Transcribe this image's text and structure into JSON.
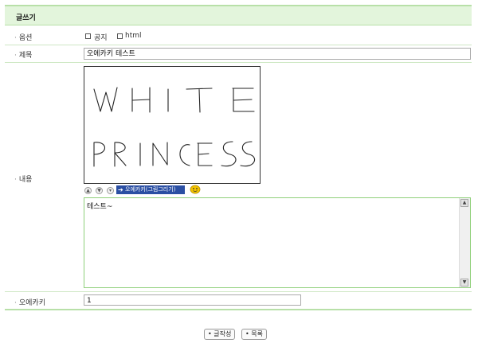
{
  "header": {
    "title": "글쓰기"
  },
  "fields": {
    "option_label": "옵션",
    "notice_label": "공지",
    "html_label": "html",
    "subject_label": "제목",
    "subject_value": "오에카키 테스트",
    "content_label": "내용",
    "content_value": "테스트~",
    "oekaki_label": "오에카키",
    "oekaki_value": "1"
  },
  "drawing": {
    "lines": [
      "WHITE",
      "PRINCESS"
    ]
  },
  "editor_toolbar": {
    "oekaki_button_label": "오에카키(그림그리기)",
    "up_glyph": "▲",
    "down_glyph": "▼",
    "collapse_glyph": "▾"
  },
  "buttons": {
    "submit": "글작성",
    "list": "목록"
  }
}
